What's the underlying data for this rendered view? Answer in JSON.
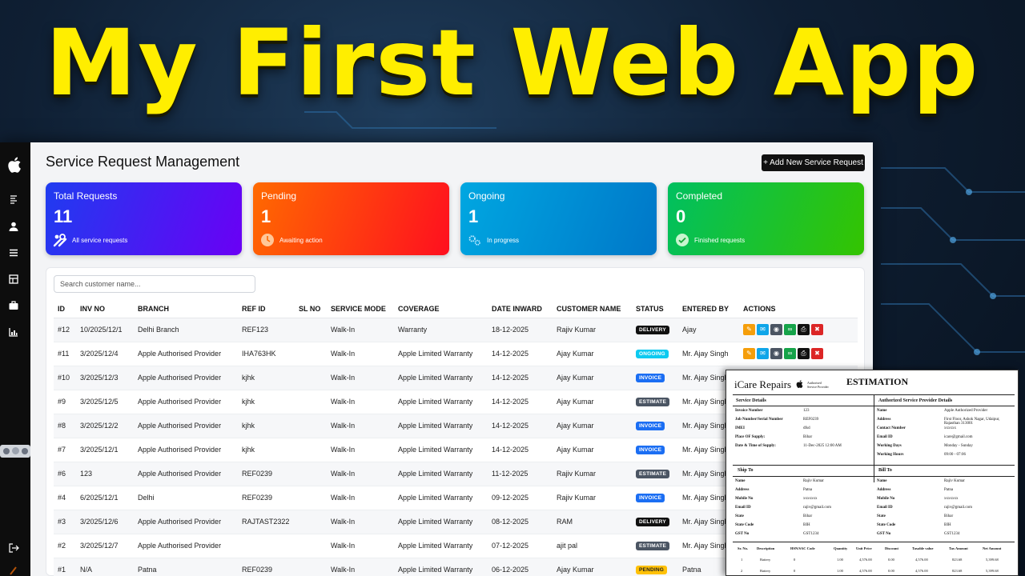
{
  "headline": "My First Web App",
  "app": {
    "page_title": "Service Request Management",
    "add_button": "+ Add New Service Request",
    "search_placeholder": "Search customer name...",
    "cards": [
      {
        "title": "Total Requests",
        "count": "11",
        "subtitle": "All service requests",
        "icon": "tools-icon"
      },
      {
        "title": "Pending",
        "count": "1",
        "subtitle": "Awaiting action",
        "icon": "clock-icon"
      },
      {
        "title": "Ongoing",
        "count": "1",
        "subtitle": "In progress",
        "icon": "gears-icon"
      },
      {
        "title": "Completed",
        "count": "0",
        "subtitle": "Finished requests",
        "icon": "check-circle-icon"
      }
    ],
    "columns": [
      "ID",
      "INV NO",
      "BRANCH",
      "REF ID",
      "SL NO",
      "SERVICE MODE",
      "COVERAGE",
      "DATE INWARD",
      "CUSTOMER NAME",
      "STATUS",
      "ENTERED BY",
      "ACTIONS"
    ],
    "rows": [
      {
        "id": "#12",
        "inv": "10/2025/12/1",
        "branch": "Delhi Branch",
        "ref": "REF123",
        "sl": "",
        "mode": "Walk-In",
        "coverage": "Warranty",
        "date": "18-12-2025",
        "customer": "Rajiv Kumar",
        "status": "DELIVERY",
        "status_class": "b-delivery",
        "entered": "Ajay"
      },
      {
        "id": "#11",
        "inv": "3/2025/12/4",
        "branch": "Apple Authorised Provider",
        "ref": "IHA763HK",
        "sl": "",
        "mode": "Walk-In",
        "coverage": "Apple Limited Warranty",
        "date": "14-12-2025",
        "customer": "Ajay Kumar",
        "status": "ONGOING",
        "status_class": "b-ongoing",
        "entered": "Mr. Ajay Singh"
      },
      {
        "id": "#10",
        "inv": "3/2025/12/3",
        "branch": "Apple Authorised Provider",
        "ref": "kjhk",
        "sl": "",
        "mode": "Walk-In",
        "coverage": "Apple Limited Warranty",
        "date": "14-12-2025",
        "customer": "Ajay Kumar",
        "status": "INVOICE",
        "status_class": "b-invoice",
        "entered": "Mr. Ajay Singh"
      },
      {
        "id": "#9",
        "inv": "3/2025/12/5",
        "branch": "Apple Authorised Provider",
        "ref": "kjhk",
        "sl": "",
        "mode": "Walk-In",
        "coverage": "Apple Limited Warranty",
        "date": "14-12-2025",
        "customer": "Ajay Kumar",
        "status": "ESTIMATE",
        "status_class": "b-estimate",
        "entered": "Mr. Ajay Singh"
      },
      {
        "id": "#8",
        "inv": "3/2025/12/2",
        "branch": "Apple Authorised Provider",
        "ref": "kjhk",
        "sl": "",
        "mode": "Walk-In",
        "coverage": "Apple Limited Warranty",
        "date": "14-12-2025",
        "customer": "Ajay Kumar",
        "status": "INVOICE",
        "status_class": "b-invoice",
        "entered": "Mr. Ajay Singh"
      },
      {
        "id": "#7",
        "inv": "3/2025/12/1",
        "branch": "Apple Authorised Provider",
        "ref": "kjhk",
        "sl": "",
        "mode": "Walk-In",
        "coverage": "Apple Limited Warranty",
        "date": "14-12-2025",
        "customer": "Ajay Kumar",
        "status": "INVOICE",
        "status_class": "b-invoice",
        "entered": "Mr. Ajay Singh"
      },
      {
        "id": "#6",
        "inv": "123",
        "branch": "Apple Authorised Provider",
        "ref": "REF0239",
        "sl": "",
        "mode": "Walk-In",
        "coverage": "Apple Limited Warranty",
        "date": "11-12-2025",
        "customer": "Rajiv Kumar",
        "status": "ESTIMATE",
        "status_class": "b-estimate",
        "entered": "Mr. Ajay Singh"
      },
      {
        "id": "#4",
        "inv": "6/2025/12/1",
        "branch": "Delhi",
        "ref": "REF0239",
        "sl": "",
        "mode": "Walk-In",
        "coverage": "Apple Limited Warranty",
        "date": "09-12-2025",
        "customer": "Rajiv Kumar",
        "status": "INVOICE",
        "status_class": "b-invoice",
        "entered": "Mr. Ajay Singh"
      },
      {
        "id": "#3",
        "inv": "3/2025/12/6",
        "branch": "Apple Authorised Provider",
        "ref": "RAJTAST2322",
        "sl": "",
        "mode": "Walk-In",
        "coverage": "Apple Limited Warranty",
        "date": "08-12-2025",
        "customer": "RAM",
        "status": "DELIVERY",
        "status_class": "b-delivery",
        "entered": "Mr. Ajay Singh"
      },
      {
        "id": "#2",
        "inv": "3/2025/12/7",
        "branch": "Apple Authorised Provider",
        "ref": "",
        "sl": "",
        "mode": "Walk-In",
        "coverage": "Apple Limited Warranty",
        "date": "07-12-2025",
        "customer": "ajit pal",
        "status": "ESTIMATE",
        "status_class": "b-estimate",
        "entered": "Mr. Ajay Singh"
      },
      {
        "id": "#1",
        "inv": "N/A",
        "branch": "Patna",
        "ref": "REF0239",
        "sl": "",
        "mode": "Walk-In",
        "coverage": "Apple Limited Warranty",
        "date": "06-12-2025",
        "customer": "Ajay Kumar",
        "status": "PENDING",
        "status_class": "b-pending",
        "entered": "Patna"
      }
    ]
  },
  "estimation": {
    "brand": "iCare Repairs",
    "auth_text": "Authorised Service Provider",
    "title": "ESTIMATION",
    "service_details_head": "Service Details",
    "provider_head": "Authorized Service Provider Details",
    "service_details": [
      {
        "label": "Invoice Number",
        "value": "123"
      },
      {
        "label": "Job Number/Serial Number",
        "value": "REF0239"
      },
      {
        "label": "IMEI",
        "value": "dfsd"
      },
      {
        "label": "Place OF Supply:",
        "value": "Bihar"
      },
      {
        "label": "Date & Time of Supply:",
        "value": "11-Dec-2025 12:00 AM"
      }
    ],
    "provider": [
      {
        "label": "Name",
        "value": "Apple Authorized Provider"
      },
      {
        "label": "Address",
        "value": "First Floor, Ashok Nagar, Udaipur, Rajasthan 313001"
      },
      {
        "label": "Contact Number",
        "value": "xxxxxx"
      },
      {
        "label": "Email ID",
        "value": "icare@gmail.com"
      },
      {
        "label": "Working Days",
        "value": "Monday - Sunday"
      },
      {
        "label": "Working Hours",
        "value": "09:00 - 07:06"
      }
    ],
    "ship_head": "Ship To",
    "bill_head": "Bill To",
    "ship": [
      {
        "label": "Name",
        "value": "Rajiv Kumar"
      },
      {
        "label": "Address",
        "value": "Patna"
      },
      {
        "label": "Mobile No",
        "value": "xxxxxxx"
      },
      {
        "label": "Email ID",
        "value": "rajiv@gmail.com"
      },
      {
        "label": "State",
        "value": "Bihar"
      },
      {
        "label": "State Code",
        "value": "BIH"
      },
      {
        "label": "GST No",
        "value": "GST1234"
      }
    ],
    "bill": [
      {
        "label": "Name",
        "value": "Rajiv Kumar"
      },
      {
        "label": "Address",
        "value": "Patna"
      },
      {
        "label": "Mobile No",
        "value": "xxxxxxx"
      },
      {
        "label": "Email ID",
        "value": "rajiv@gmail.com"
      },
      {
        "label": "State",
        "value": "Bihar"
      },
      {
        "label": "State Code",
        "value": "BIH"
      },
      {
        "label": "GST No",
        "value": "GST1234"
      }
    ],
    "items_columns": [
      "Sr. No.",
      "Description",
      "HSN/SAC Code",
      "Quantity",
      "Unit Price",
      "Discount",
      "Taxable value",
      "Tax Amount",
      "Net Amount"
    ],
    "items": [
      [
        "1",
        "Battery",
        "0",
        "1.00",
        "4,576.00",
        "0.00",
        "4,576.00",
        "823.68",
        "5,399.68"
      ],
      [
        "2",
        "Battery",
        "0",
        "1.00",
        "4,576.00",
        "0.00",
        "4,576.00",
        "823.68",
        "5,399.68"
      ]
    ]
  },
  "colors": {
    "headline": "#ffee00",
    "total": "#1f3cf0",
    "pending": "#ff3b0f",
    "ongoing": "#0096d6",
    "completed": "#1cc23a"
  }
}
